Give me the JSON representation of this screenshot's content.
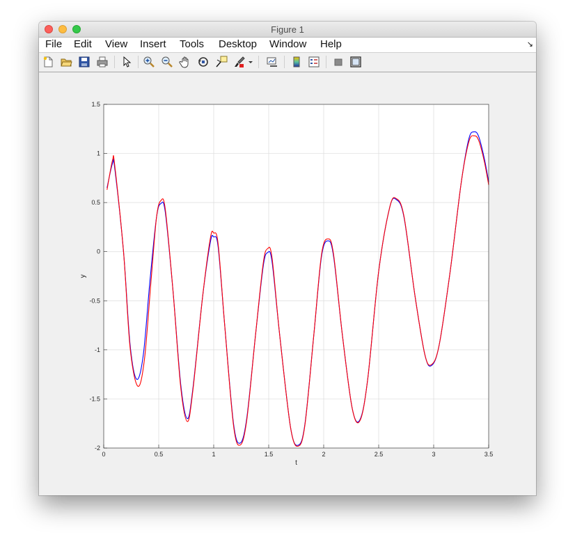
{
  "window": {
    "title": "Figure 1"
  },
  "menu": [
    "File",
    "Edit",
    "View",
    "Insert",
    "Tools",
    "Desktop",
    "Window",
    "Help"
  ],
  "toolbar": [
    {
      "name": "new-figure-icon",
      "x": 13
    },
    {
      "name": "open-file-icon",
      "x": 38
    },
    {
      "name": "save-figure-icon",
      "x": 64
    },
    {
      "name": "print-figure-icon",
      "x": 90
    },
    {
      "name": "edit-plot-icon",
      "x": 123
    },
    {
      "name": "zoom-in-icon",
      "x": 157
    },
    {
      "name": "zoom-out-icon",
      "x": 183
    },
    {
      "name": "pan-icon",
      "x": 209
    },
    {
      "name": "rotate-3d-icon",
      "x": 235
    },
    {
      "name": "data-cursor-icon",
      "x": 261
    },
    {
      "name": "brush-icon",
      "x": 286
    },
    {
      "name": "brush-dropdown-icon",
      "x": 304
    },
    {
      "name": "link-plot-icon",
      "x": 327
    },
    {
      "name": "insert-colorbar-icon",
      "x": 362
    },
    {
      "name": "insert-legend-icon",
      "x": 387
    },
    {
      "name": "hide-plot-tools-icon",
      "x": 422
    },
    {
      "name": "show-plot-tools-icon",
      "x": 447
    }
  ],
  "colors": {
    "series_blue": "#0000ff",
    "series_red": "#ff0000"
  },
  "chart_data": {
    "type": "line",
    "title": "",
    "xlabel": "t",
    "ylabel": "y",
    "xlim": [
      0,
      3.5
    ],
    "ylim": [
      -2,
      1.5
    ],
    "grid": true,
    "xticks": [
      0,
      0.5,
      1,
      1.5,
      2,
      2.5,
      3,
      3.5
    ],
    "xtick_labels": [
      "0",
      "0.5",
      "1",
      "1.5",
      "2",
      "2.5",
      "3",
      "3.5"
    ],
    "yticks": [
      1.5,
      1,
      0.5,
      0,
      -0.5,
      -1,
      -1.5,
      -2
    ],
    "ytick_labels": [
      "1.5",
      "1",
      "0.5",
      "0",
      "-0.5",
      "-1",
      "-1.5",
      "-2"
    ],
    "series": [
      {
        "color": "#0000ff",
        "points": [
          [
            0.03,
            0.65
          ],
          [
            0.08,
            0.9
          ],
          [
            0.1,
            0.85
          ],
          [
            0.18,
            0.0
          ],
          [
            0.24,
            -0.95
          ],
          [
            0.3,
            -1.3
          ],
          [
            0.36,
            -1.05
          ],
          [
            0.42,
            -0.3
          ],
          [
            0.48,
            0.35
          ],
          [
            0.52,
            0.49
          ],
          [
            0.56,
            0.4
          ],
          [
            0.63,
            -0.4
          ],
          [
            0.7,
            -1.35
          ],
          [
            0.76,
            -1.7
          ],
          [
            0.81,
            -1.4
          ],
          [
            0.9,
            -0.45
          ],
          [
            0.97,
            0.1
          ],
          [
            1.0,
            0.15
          ],
          [
            1.04,
            0.05
          ],
          [
            1.1,
            -0.75
          ],
          [
            1.18,
            -1.75
          ],
          [
            1.24,
            -1.95
          ],
          [
            1.3,
            -1.7
          ],
          [
            1.38,
            -0.85
          ],
          [
            1.45,
            -0.15
          ],
          [
            1.49,
            -0.01
          ],
          [
            1.53,
            -0.1
          ],
          [
            1.6,
            -0.85
          ],
          [
            1.7,
            -1.8
          ],
          [
            1.77,
            -1.97
          ],
          [
            1.83,
            -1.75
          ],
          [
            1.91,
            -0.85
          ],
          [
            1.98,
            -0.05
          ],
          [
            2.04,
            0.11
          ],
          [
            2.09,
            -0.05
          ],
          [
            2.17,
            -0.85
          ],
          [
            2.26,
            -1.6
          ],
          [
            2.33,
            -1.71
          ],
          [
            2.4,
            -1.3
          ],
          [
            2.5,
            -0.2
          ],
          [
            2.6,
            0.45
          ],
          [
            2.66,
            0.53
          ],
          [
            2.73,
            0.35
          ],
          [
            2.83,
            -0.45
          ],
          [
            2.92,
            -1.05
          ],
          [
            2.98,
            -1.16
          ],
          [
            3.05,
            -0.95
          ],
          [
            3.15,
            -0.2
          ],
          [
            3.25,
            0.7
          ],
          [
            3.32,
            1.15
          ],
          [
            3.37,
            1.22
          ],
          [
            3.41,
            1.17
          ],
          [
            3.46,
            0.95
          ],
          [
            3.5,
            0.71
          ]
        ]
      },
      {
        "color": "#ff0000",
        "points": [
          [
            0.03,
            0.63
          ],
          [
            0.08,
            0.93
          ],
          [
            0.1,
            0.88
          ],
          [
            0.18,
            0.0
          ],
          [
            0.24,
            -0.98
          ],
          [
            0.31,
            -1.37
          ],
          [
            0.37,
            -1.1
          ],
          [
            0.43,
            -0.3
          ],
          [
            0.48,
            0.35
          ],
          [
            0.52,
            0.52
          ],
          [
            0.56,
            0.43
          ],
          [
            0.63,
            -0.4
          ],
          [
            0.7,
            -1.38
          ],
          [
            0.76,
            -1.73
          ],
          [
            0.81,
            -1.42
          ],
          [
            0.9,
            -0.45
          ],
          [
            0.97,
            0.14
          ],
          [
            1.0,
            0.19
          ],
          [
            1.04,
            0.08
          ],
          [
            1.1,
            -0.75
          ],
          [
            1.18,
            -1.77
          ],
          [
            1.24,
            -1.97
          ],
          [
            1.3,
            -1.72
          ],
          [
            1.38,
            -0.85
          ],
          [
            1.45,
            -0.12
          ],
          [
            1.49,
            0.03
          ],
          [
            1.53,
            -0.06
          ],
          [
            1.6,
            -0.85
          ],
          [
            1.7,
            -1.8
          ],
          [
            1.77,
            -1.98
          ],
          [
            1.83,
            -1.76
          ],
          [
            1.91,
            -0.85
          ],
          [
            1.98,
            -0.03
          ],
          [
            2.04,
            0.13
          ],
          [
            2.09,
            -0.03
          ],
          [
            2.17,
            -0.85
          ],
          [
            2.26,
            -1.6
          ],
          [
            2.33,
            -1.72
          ],
          [
            2.4,
            -1.3
          ],
          [
            2.5,
            -0.2
          ],
          [
            2.6,
            0.45
          ],
          [
            2.66,
            0.54
          ],
          [
            2.73,
            0.36
          ],
          [
            2.83,
            -0.45
          ],
          [
            2.92,
            -1.05
          ],
          [
            2.98,
            -1.15
          ],
          [
            3.05,
            -0.95
          ],
          [
            3.15,
            -0.2
          ],
          [
            3.25,
            0.7
          ],
          [
            3.32,
            1.12
          ],
          [
            3.37,
            1.18
          ],
          [
            3.41,
            1.13
          ],
          [
            3.46,
            0.92
          ],
          [
            3.5,
            0.68
          ]
        ]
      }
    ]
  }
}
